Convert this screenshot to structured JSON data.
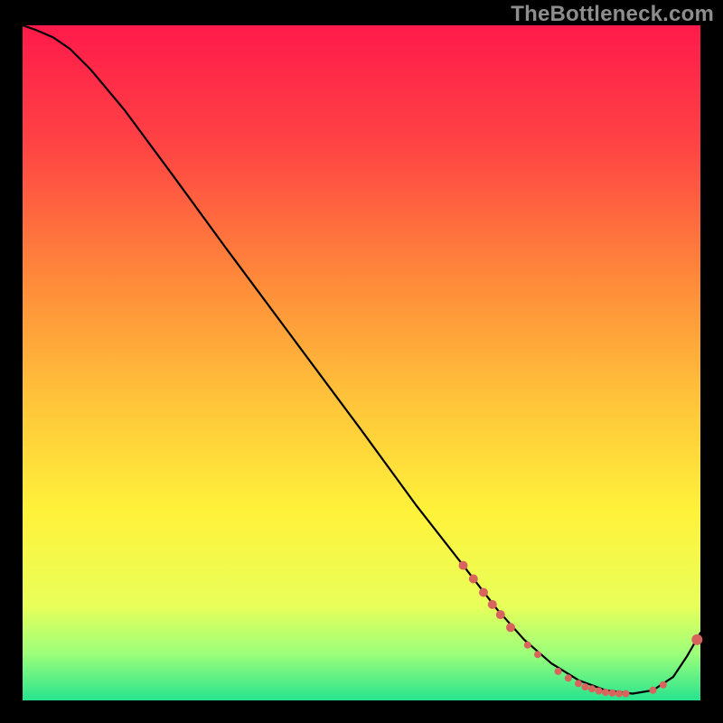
{
  "watermark": "TheBottleneck.com",
  "chart_data": {
    "type": "line",
    "title": "",
    "xlabel": "",
    "ylabel": "",
    "xlim": [
      0,
      100
    ],
    "ylim": [
      0,
      100
    ],
    "grid": false,
    "legend": false,
    "background_gradient": {
      "stops": [
        {
          "offset": 0.0,
          "color": "#ff1a4b"
        },
        {
          "offset": 0.18,
          "color": "#ff4444"
        },
        {
          "offset": 0.38,
          "color": "#ff8b3a"
        },
        {
          "offset": 0.55,
          "color": "#ffc23a"
        },
        {
          "offset": 0.72,
          "color": "#fff23a"
        },
        {
          "offset": 0.86,
          "color": "#e8ff5a"
        },
        {
          "offset": 0.93,
          "color": "#9dff7a"
        },
        {
          "offset": 1.0,
          "color": "#27e38f"
        }
      ]
    },
    "series": [
      {
        "name": "curve",
        "x": [
          0.0,
          2.0,
          4.5,
          7.0,
          10.0,
          15.0,
          22.0,
          30.0,
          40.0,
          50.0,
          58.0,
          65.0,
          70.0,
          74.0,
          78.0,
          82.0,
          86.0,
          90.0,
          93.0,
          96.0,
          98.0,
          100.0
        ],
        "y": [
          100.0,
          99.3,
          98.2,
          96.5,
          93.5,
          87.5,
          78.0,
          67.0,
          53.5,
          40.0,
          29.0,
          20.0,
          13.5,
          9.0,
          5.5,
          3.0,
          1.5,
          1.0,
          1.5,
          3.5,
          6.5,
          10.0
        ]
      }
    ],
    "highlight_points": {
      "name": "markers",
      "color": "#d7655e",
      "points": [
        {
          "x": 65.0,
          "y": 20.0,
          "r": 5
        },
        {
          "x": 66.5,
          "y": 18.0,
          "r": 5
        },
        {
          "x": 68.0,
          "y": 16.0,
          "r": 5
        },
        {
          "x": 69.3,
          "y": 14.2,
          "r": 5
        },
        {
          "x": 70.5,
          "y": 12.7,
          "r": 5
        },
        {
          "x": 72.0,
          "y": 10.8,
          "r": 5
        },
        {
          "x": 74.5,
          "y": 8.2,
          "r": 4
        },
        {
          "x": 76.0,
          "y": 6.8,
          "r": 4
        },
        {
          "x": 79.0,
          "y": 4.3,
          "r": 4
        },
        {
          "x": 80.5,
          "y": 3.3,
          "r": 4
        },
        {
          "x": 82.0,
          "y": 2.5,
          "r": 4
        },
        {
          "x": 83.0,
          "y": 2.0,
          "r": 4
        },
        {
          "x": 84.0,
          "y": 1.7,
          "r": 4
        },
        {
          "x": 85.0,
          "y": 1.4,
          "r": 4
        },
        {
          "x": 86.0,
          "y": 1.2,
          "r": 4
        },
        {
          "x": 87.0,
          "y": 1.1,
          "r": 4
        },
        {
          "x": 88.0,
          "y": 1.0,
          "r": 4
        },
        {
          "x": 89.0,
          "y": 1.0,
          "r": 4
        },
        {
          "x": 93.0,
          "y": 1.5,
          "r": 4
        },
        {
          "x": 94.5,
          "y": 2.3,
          "r": 4
        },
        {
          "x": 99.5,
          "y": 9.0,
          "r": 6
        }
      ]
    }
  }
}
